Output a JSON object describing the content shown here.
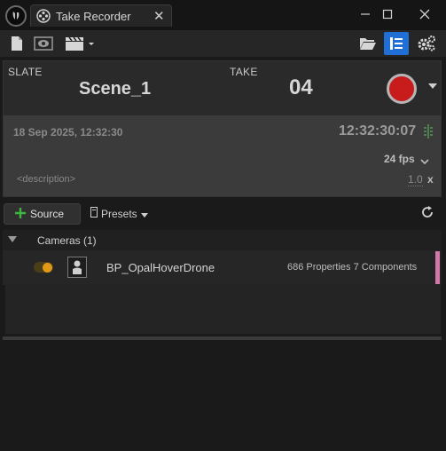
{
  "window": {
    "tab_title": "Take Recorder",
    "tab_close": "✕",
    "minimize": "—",
    "maximize": "☐",
    "close": "✕"
  },
  "toolbar": {
    "left_icons": [
      "new-document-icon",
      "review-last-take-icon",
      "clapperboard-icon"
    ],
    "right_icons": [
      "folder-open-icon",
      "take-browser-icon",
      "settings-icon"
    ]
  },
  "slate": {
    "slate_label": "SLATE",
    "slate_value": "Scene_1",
    "take_label": "TAKE",
    "take_value": "04",
    "record_color": "#c81c1c"
  },
  "info": {
    "datetime": "18 Sep 2025, 12:32:30",
    "timecode": "12:32:30:07",
    "frame_rate": "24 fps",
    "description_placeholder": "<description>",
    "time_scale": "1.0",
    "time_scale_unit": "x"
  },
  "sources": {
    "add_label": "Source",
    "presets_label": "Presets",
    "group_label": "Cameras (1)",
    "items": [
      {
        "name": "BP_OpalHoverDrone",
        "details": "686 Properties 7 Components",
        "enabled": true,
        "accent": "#d17aa8"
      }
    ]
  },
  "colors": {
    "accent_blue": "#1f6fd6",
    "toggle_on": "#e09a18"
  }
}
